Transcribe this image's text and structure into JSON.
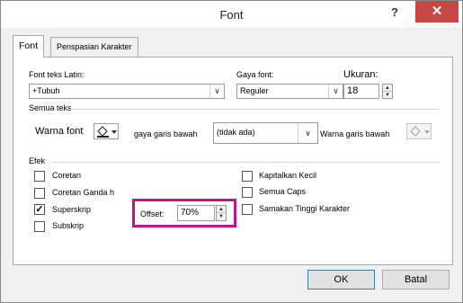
{
  "window": {
    "title": "Font",
    "help_label": "?",
    "close_label": "✕"
  },
  "tabs": [
    {
      "label": "Font",
      "active": true
    },
    {
      "label": "Penspasian Karakter",
      "active": false
    }
  ],
  "font_section": {
    "latin_label": "Font teks Latin:",
    "latin_value": "+Tubuh",
    "style_label": "Gaya font:",
    "style_value": "Reguler",
    "size_label": "Ukuran:",
    "size_value": "18"
  },
  "all_text": {
    "heading": "Semua teks",
    "font_color_label": "Warna font",
    "underline_style_label": "gaya garis bawah",
    "underline_style_value": "(tidak ada)",
    "underline_color_label": "Warna garis bawah"
  },
  "effects": {
    "heading": "Efek",
    "left": [
      {
        "label": "Coretan",
        "checked": false
      },
      {
        "label": "Coretan Ganda h",
        "checked": false
      },
      {
        "label": "Superskrip",
        "checked": true
      },
      {
        "label": "Subskrip",
        "checked": false
      }
    ],
    "right": [
      {
        "label": "Kapitalkan Kecil",
        "checked": false
      },
      {
        "label": "Semua Caps",
        "checked": false
      },
      {
        "label": "Samakan Tinggi Karakter",
        "checked": false
      }
    ],
    "offset_label": "Offset:",
    "offset_value": "70%"
  },
  "buttons": {
    "ok": "OK",
    "cancel": "Batal"
  },
  "colors": {
    "close_button": "#c74744",
    "highlight": "#c0168a",
    "default_button_border": "#3c7fb1"
  }
}
